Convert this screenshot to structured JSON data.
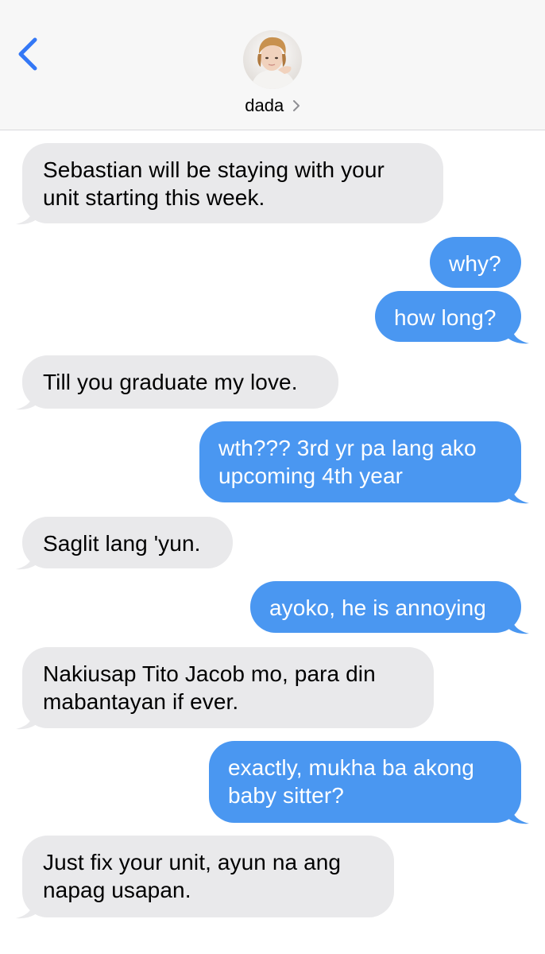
{
  "header": {
    "contact_name": "dada",
    "back_icon": "chevron-left-icon",
    "contact_chevron_icon": "chevron-right-icon"
  },
  "colors": {
    "incoming_bubble": "#e9e9eb",
    "outgoing_bubble": "#4a97f1",
    "accent": "#3478f6"
  },
  "messages": [
    {
      "direction": "incoming",
      "text": "Sebastian will be staying with your\nunit starting this week."
    },
    {
      "direction": "outgoing",
      "text": "why?"
    },
    {
      "direction": "outgoing",
      "text": "how long?"
    },
    {
      "direction": "incoming",
      "text": "Till you graduate my love."
    },
    {
      "direction": "outgoing",
      "text": "wth??? 3rd yr pa lang ako\nupcoming 4th year"
    },
    {
      "direction": "incoming",
      "text": "Saglit lang 'yun."
    },
    {
      "direction": "outgoing",
      "text": "ayoko, he is annoying"
    },
    {
      "direction": "incoming",
      "text": "Nakiusap Tito Jacob mo, para din\nmabantayan if ever."
    },
    {
      "direction": "outgoing",
      "text": "exactly, mukha ba akong\nbaby sitter?"
    },
    {
      "direction": "incoming",
      "text": "Just fix your unit, ayun na ang\nnapag usapan."
    }
  ]
}
